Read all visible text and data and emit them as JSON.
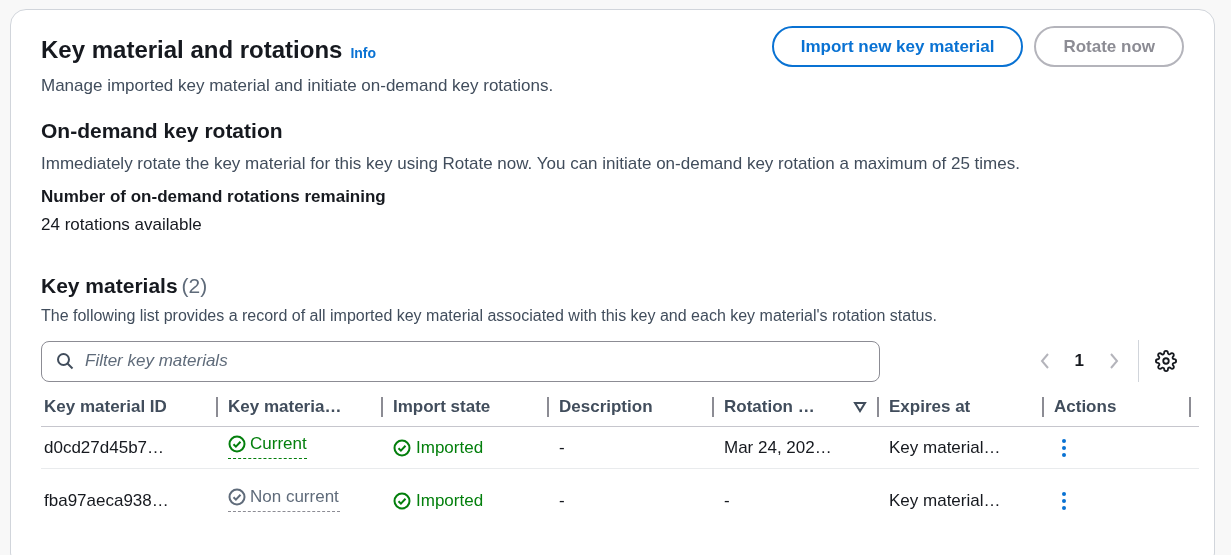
{
  "header": {
    "title": "Key material and rotations",
    "info_link": "Info",
    "description": "Manage imported key material and initiate on-demand key rotations.",
    "buttons": [
      {
        "label": "Import new key material",
        "disabled": false
      },
      {
        "label": "Rotate now",
        "disabled": true
      }
    ]
  },
  "on_demand": {
    "title": "On-demand key rotation",
    "description": "Immediately rotate the key material for this key using Rotate now. You can initiate on-demand key rotation a maximum of 25 times.",
    "remaining_label": "Number of on-demand rotations remaining",
    "remaining_value": "24 rotations available"
  },
  "key_materials": {
    "title": "Key materials",
    "count": "(2)",
    "description": "The following list provides a record of all imported key material associated with this key and each key material's rotation status.",
    "filter": {
      "placeholder": "Filter key materials"
    },
    "pagination": {
      "prev_disabled": true,
      "next_disabled": true,
      "pages": [
        {
          "label": "1",
          "selected": true
        }
      ]
    },
    "table": {
      "columns": [
        {
          "label": "Key material ID",
          "sorted": false
        },
        {
          "label": "Key materia…",
          "sorted": false
        },
        {
          "label": "Import state",
          "sorted": false
        },
        {
          "label": "Description",
          "sorted": false
        },
        {
          "label": "Rotation …",
          "sorted": true
        },
        {
          "label": "Expires at",
          "sorted": false
        },
        {
          "label": "Actions",
          "sorted": false
        }
      ],
      "rows": [
        {
          "id": "d0cd27d45b7…",
          "status": {
            "kind": "current",
            "label": "Current"
          },
          "import_state": "Imported",
          "description": "-",
          "rotation": "Mar 24, 202…",
          "expires": "Key material…"
        },
        {
          "id": "fba97aeca938…",
          "status": {
            "kind": "noncurrent",
            "label": "Non current"
          },
          "import_state": "Imported",
          "description": "-",
          "rotation": "-",
          "expires": "Key material…"
        }
      ]
    }
  }
}
